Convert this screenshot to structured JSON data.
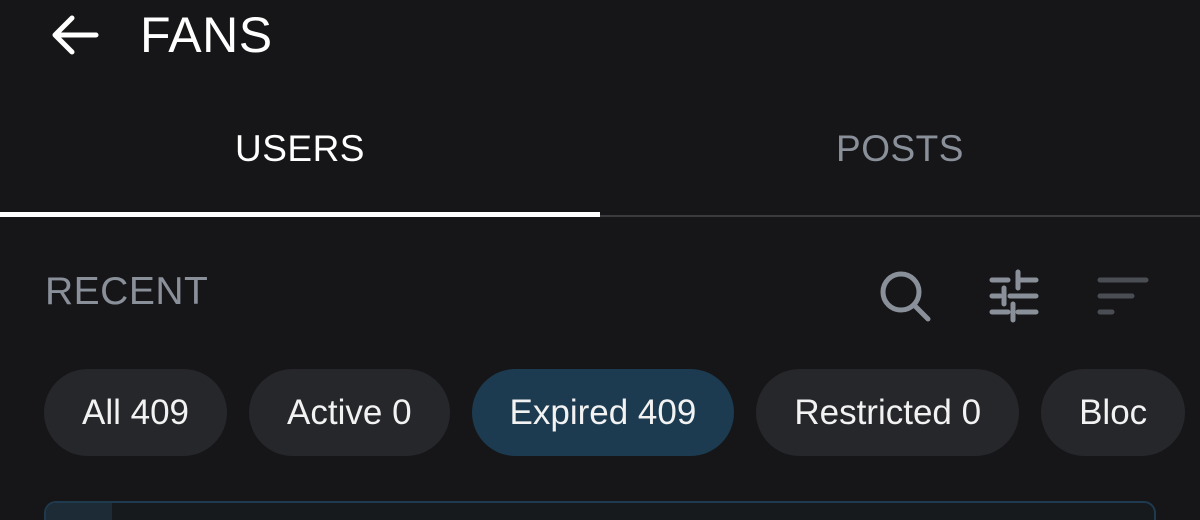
{
  "header": {
    "title": "FANS",
    "back_icon": "arrow-left-icon"
  },
  "tabs": [
    {
      "label": "USERS",
      "active": true
    },
    {
      "label": "POSTS",
      "active": false
    }
  ],
  "section": {
    "title": "RECENT",
    "actions": [
      "search-icon",
      "filter-sliders-icon",
      "sort-icon"
    ]
  },
  "chips": [
    {
      "label": "All 409",
      "selected": false
    },
    {
      "label": "Active 0",
      "selected": false
    },
    {
      "label": "Expired 409",
      "selected": true
    },
    {
      "label": "Restricted 0",
      "selected": false
    },
    {
      "label": "Bloc",
      "selected": false
    }
  ],
  "colors": {
    "background": "#161618",
    "chip": "#26272b",
    "chip_selected": "#1c3b50",
    "muted_text": "#8a9099",
    "active_text": "#ffffff"
  }
}
